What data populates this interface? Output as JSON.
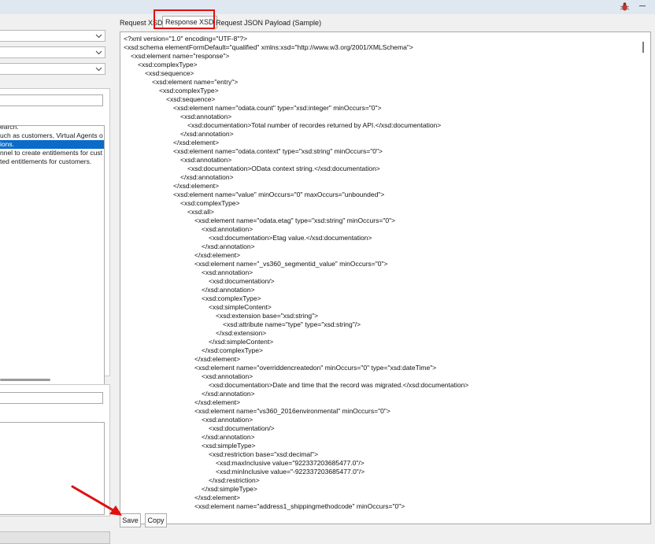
{
  "tabs": [
    {
      "label": "Request XSD"
    },
    {
      "label": "Response XSD"
    },
    {
      "label": "Request JSON Payload (Sample)"
    }
  ],
  "left": {
    "description_lines": [
      "earch.",
      "uch as customers, Virtual Agents o",
      "ions.",
      "nnel to create entitlements for cust",
      "ted entitlements for customers."
    ],
    "selected_line_index": 2
  },
  "xsd_lines": [
    "<?xml version=\"1.0\" encoding=\"UTF-8\"?>",
    "<xsd:schema elementFormDefault=\"qualified\" xmlns:xsd=\"http://www.w3.org/2001/XMLSchema\">",
    "<xsd:element name=\"response\">",
    "<xsd:complexType>",
    "<xsd:sequence>",
    "<xsd:element name=\"entry\">",
    "<xsd:complexType>",
    "<xsd:sequence>",
    "<xsd:element name=\"odata.count\" type=\"xsd:integer\" minOccurs=\"0\">",
    "<xsd:annotation>",
    "<xsd:documentation>Total number of recordes returned by API.</xsd:documentation>",
    "</xsd:annotation>",
    "</xsd:element>",
    "<xsd:element name=\"odata.context\" type=\"xsd:string\" minOccurs=\"0\">",
    "<xsd:annotation>",
    "<xsd:documentation>OData context string.</xsd:documentation>",
    "</xsd:annotation>",
    "</xsd:element>",
    "<xsd:element name=\"value\" minOccurs=\"0\" maxOccurs=\"unbounded\">",
    "<xsd:complexType>",
    "<xsd:all>",
    "<xsd:element name=\"odata.etag\" type=\"xsd:string\" minOccurs=\"0\">",
    "<xsd:annotation>",
    "<xsd:documentation>Etag value.</xsd:documentation>",
    "</xsd:annotation>",
    "</xsd:element>",
    "<xsd:element name=\"_vs360_segmentid_value\" minOccurs=\"0\">",
    "<xsd:annotation>",
    "<xsd:documentation/>",
    "</xsd:annotation>",
    "<xsd:complexType>",
    "<xsd:simpleContent>",
    "<xsd:extension base=\"xsd:string\">",
    "<xsd:attribute name=\"type\" type=\"xsd:string\"/>",
    "</xsd:extension>",
    "</xsd:simpleContent>",
    "</xsd:complexType>",
    "</xsd:element>",
    "<xsd:element name=\"overriddencreatedon\" minOccurs=\"0\" type=\"xsd:dateTime\">",
    "<xsd:annotation>",
    "<xsd:documentation>Date and time that the record was migrated.</xsd:documentation>",
    "</xsd:annotation>",
    "</xsd:element>",
    "<xsd:element name=\"vs360_2016environmental\" minOccurs=\"0\">",
    "<xsd:annotation>",
    "<xsd:documentation/>",
    "</xsd:annotation>",
    "<xsd:simpleType>",
    "<xsd:restriction base=\"xsd:decimal\">",
    "<xsd:maxInclusive value=\"922337203685477.0\"/>",
    "<xsd:minInclusive value=\"-922337203685477.0\"/>",
    "</xsd:restriction>",
    "</xsd:simpleType>",
    "</xsd:element>",
    "<xsd:element name=\"address1_shippingmethodcode\" minOccurs=\"0\">"
  ],
  "buttons": {
    "save": "Save",
    "copy": "Copy"
  },
  "colors": {
    "highlight": "#e01010",
    "selection": "#0a6bc9"
  }
}
